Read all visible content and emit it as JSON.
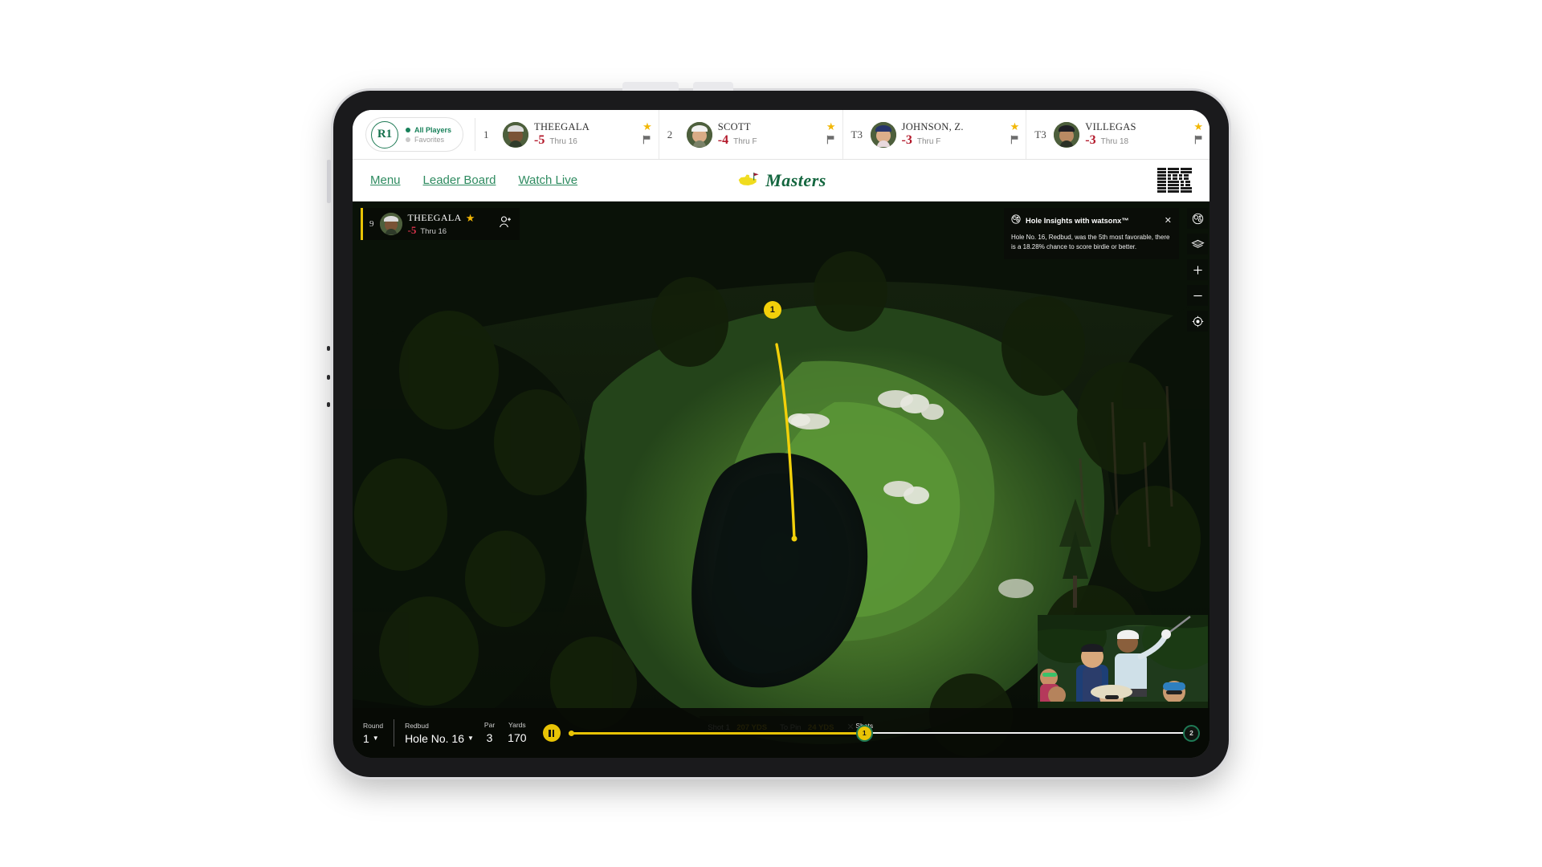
{
  "leaderboard": {
    "round_badge": "R1",
    "filters": [
      {
        "label": "All Players",
        "active": true
      },
      {
        "label": "Favorites",
        "active": false
      }
    ],
    "players": [
      {
        "pos": "1",
        "name": "THEEGALA",
        "score": "-5",
        "thru": "Thru 16",
        "starred": true,
        "avatar_cap": "#dcdcdc",
        "avatar_shirt": "#2f3b2a",
        "avatar_skin": "#7a5336"
      },
      {
        "pos": "2",
        "name": "SCOTT",
        "score": "-4",
        "thru": "Thru F",
        "starred": true,
        "avatar_cap": "#f2f2f2",
        "avatar_shirt": "#7b8268",
        "avatar_skin": "#d8ab86"
      },
      {
        "pos": "T3",
        "name": "JOHNSON, Z.",
        "score": "-3",
        "thru": "Thru F",
        "starred": true,
        "avatar_cap": "#27356b",
        "avatar_shirt": "#e8d9dd",
        "avatar_skin": "#dcae8a"
      },
      {
        "pos": "T3",
        "name": "VILLEGAS",
        "score": "-3",
        "thru": "Thru 18",
        "starred": true,
        "avatar_cap": "#1f1f25",
        "avatar_shirt": "#2b3126",
        "avatar_skin": "#b98a63"
      }
    ]
  },
  "nav": {
    "links": [
      "Menu",
      "Leader Board",
      "Watch Live"
    ],
    "brand": "Masters",
    "sponsor": "IBM"
  },
  "player_card": {
    "pos": "9",
    "name": "THEEGALA",
    "score": "-5",
    "thru": "Thru 16",
    "starred": true,
    "add_icon": "add-person-icon"
  },
  "insights": {
    "title": "Hole Insights with watsonx™",
    "body": "Hole No. 16, Redbud, was the 5th most favorable, there is a 18.28% chance to score birdie or better.",
    "close_label": "✕",
    "icon": "watsonx-icon"
  },
  "tool_rail": [
    {
      "name": "watsonx-insights-icon"
    },
    {
      "name": "layers-icon"
    },
    {
      "name": "zoom-in-icon"
    },
    {
      "name": "zoom-out-icon"
    },
    {
      "name": "recenter-icon"
    }
  ],
  "shot_pill": {
    "shot_label": "Shot 1",
    "shot_value": "207 YDS",
    "topin_label": "To Pin",
    "topin_value": "24 YDS",
    "close_label": "✕"
  },
  "hole_bar": {
    "round_label": "Round",
    "round_value": "1",
    "course_label": "Redbud",
    "hole_value": "Hole No. 16",
    "par_label": "Par",
    "par_value": "3",
    "yards_label": "Yards",
    "yards_value": "170",
    "shots_label": "Shots",
    "play_state": "pause",
    "shot_markers": [
      {
        "label": "1",
        "active": true
      },
      {
        "label": "2",
        "active": false
      }
    ]
  },
  "map": {
    "shot_marker_label": "1",
    "trajectory_color": "#f2d00a",
    "hole_name": "Redbud"
  },
  "colors": {
    "masters_green": "#14663f",
    "nav_green": "#2e8b60",
    "score_red": "#b3192b",
    "accent_yellow": "#e8c305",
    "star_gold": "#f2b705"
  }
}
